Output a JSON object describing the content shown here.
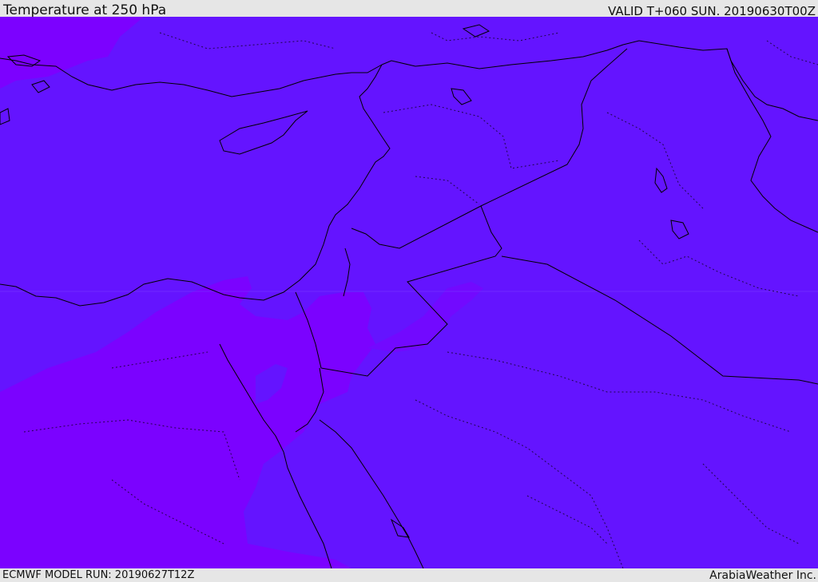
{
  "header": {
    "title": "Temperature at 250 hPa",
    "valid": "VALID T+060 SUN. 20190630T00Z"
  },
  "footer": {
    "model_run": "ECMWF MODEL RUN: 20190627T12Z",
    "credit": "ArabiaWeather Inc."
  },
  "map": {
    "region": "Eastern Mediterranean and Middle East",
    "colors": {
      "field_main": "#6414ff",
      "field_warm": "#7d00ff",
      "field_mid": "#7209ff",
      "coastline": "#000000",
      "border": "#000000"
    }
  }
}
